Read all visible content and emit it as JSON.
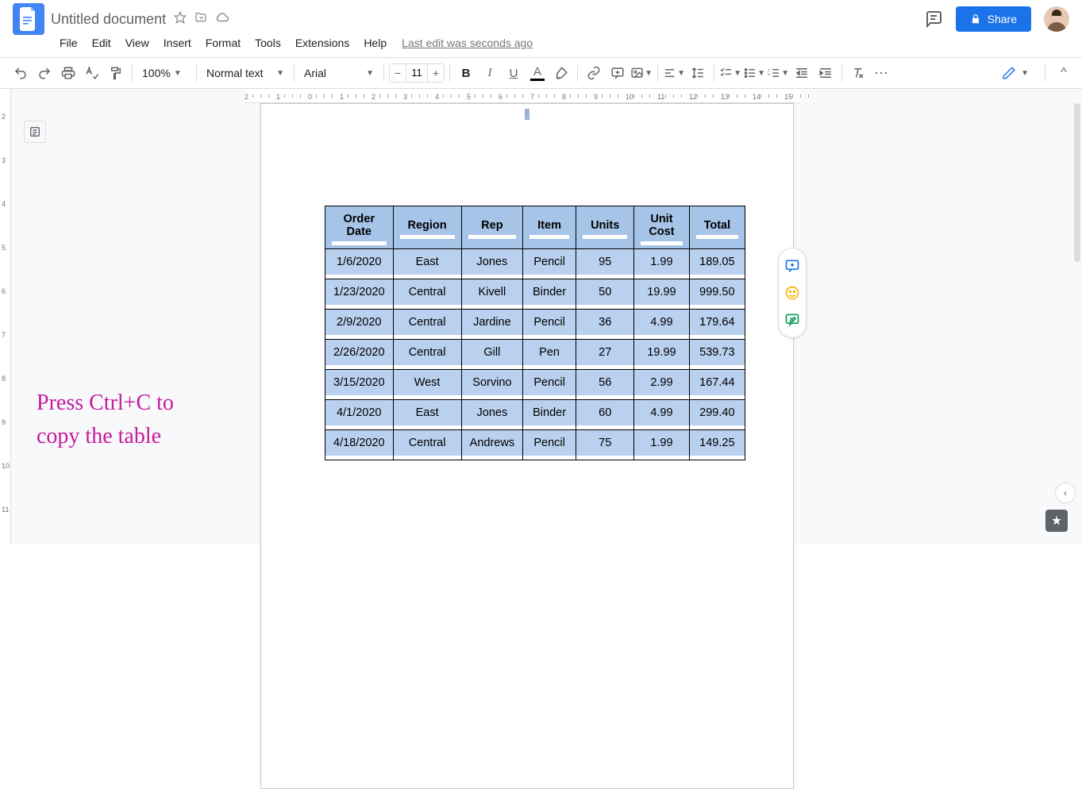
{
  "doc_title": "Untitled document",
  "menus": [
    "File",
    "Edit",
    "View",
    "Insert",
    "Format",
    "Tools",
    "Extensions",
    "Help"
  ],
  "last_edit": "Last edit was seconds ago",
  "share_label": "Share",
  "toolbar": {
    "zoom": "100%",
    "para_style": "Normal text",
    "font": "Arial",
    "font_size": "11"
  },
  "annotation": {
    "line1": "Press Ctrl+C to",
    "line2": "copy the table"
  },
  "table": {
    "headers": [
      "Order Date",
      "Region",
      "Rep",
      "Item",
      "Units",
      "Unit Cost",
      "Total"
    ],
    "rows": [
      [
        "1/6/2020",
        "East",
        "Jones",
        "Pencil",
        "95",
        "1.99",
        "189.05"
      ],
      [
        "1/23/2020",
        "Central",
        "Kivell",
        "Binder",
        "50",
        "19.99",
        "999.50"
      ],
      [
        "2/9/2020",
        "Central",
        "Jardine",
        "Pencil",
        "36",
        "4.99",
        "179.64"
      ],
      [
        "2/26/2020",
        "Central",
        "Gill",
        "Pen",
        "27",
        "19.99",
        "539.73"
      ],
      [
        "3/15/2020",
        "West",
        "Sorvino",
        "Pencil",
        "56",
        "2.99",
        "167.44"
      ],
      [
        "4/1/2020",
        "East",
        "Jones",
        "Binder",
        "60",
        "4.99",
        "299.40"
      ],
      [
        "4/18/2020",
        "Central",
        "Andrews",
        "Pencil",
        "75",
        "1.99",
        "149.25"
      ]
    ]
  }
}
